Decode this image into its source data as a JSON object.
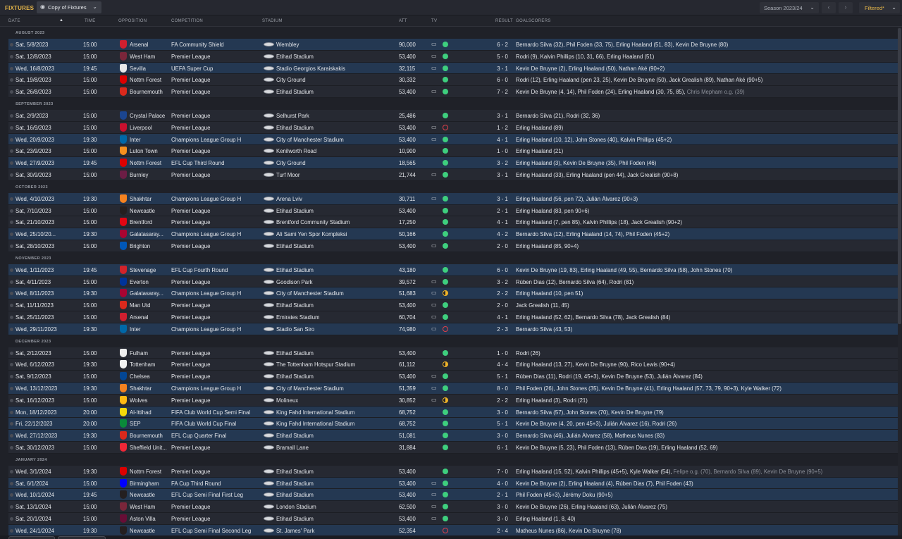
{
  "header": {
    "title": "FIXTURES",
    "view_select": "Copy of Fixtures",
    "season_select": "Season 2023/24",
    "filter_select": "Filtered*"
  },
  "columns": {
    "date": "DATE",
    "time": "TIME",
    "opposition": "OPPOSITION",
    "competition": "COMPETITION",
    "stadium": "STADIUM",
    "att": "ATT",
    "tv": "TV",
    "result": "RESULT",
    "goalscorers": "GOALSCORERS"
  },
  "colors": {
    "win": "#3ecf7e",
    "loss": "#e0404a",
    "draw": "#f0b429",
    "highlight_row": "#243852",
    "accent": "#e8b84a"
  },
  "months": [
    {
      "label": "AUGUST 2023",
      "rows": [
        {
          "date": "Sat, 5/8/2023",
          "time": "15:00",
          "opp": "Arsenal",
          "badge": "#d01f2f",
          "comp": "FA Community Shield",
          "stadium": "Wembley",
          "att": "90,000",
          "tv": true,
          "res": "win",
          "score": "6 - 2",
          "scorers": "Bernardo Silva (32), Phil Foden (33, 75), Erling Haaland (51, 83), Kevin De Bruyne (80)",
          "extra": "",
          "hl": true
        },
        {
          "date": "Sat, 12/8/2023",
          "time": "15:00",
          "opp": "West Ham",
          "badge": "#7a263a",
          "comp": "Premier League",
          "stadium": "Etihad Stadium",
          "att": "53,400",
          "tv": true,
          "res": "win",
          "score": "5 - 0",
          "scorers": "Rodri (9), Kalvin Phillips (10, 31, 66), Erling Haaland (51)",
          "extra": "",
          "hl": false
        },
        {
          "date": "Wed, 16/8/2023",
          "time": "19:45",
          "opp": "Sevilla",
          "badge": "#e8e8e8",
          "comp": "UEFA Super Cup",
          "stadium": "Stadio Georgios Karaiskakis",
          "att": "32,115",
          "tv": true,
          "res": "win",
          "score": "3 - 1",
          "scorers": "Kevin De Bruyne (2), Erling Haaland (50), Nathan Aké (90+2)",
          "extra": "",
          "hl": true
        },
        {
          "date": "Sat, 19/8/2023",
          "time": "15:00",
          "opp": "Nottm Forest",
          "badge": "#dd0000",
          "comp": "Premier League",
          "stadium": "City Ground",
          "att": "30,332",
          "tv": false,
          "res": "win",
          "score": "6 - 0",
          "scorers": "Rodri (12), Erling Haaland (pen 23, 25), Kevin De Bruyne (50), Jack Grealish (89), Nathan Aké (90+5)",
          "extra": "",
          "hl": false
        },
        {
          "date": "Sat, 26/8/2023",
          "time": "15:00",
          "opp": "Bournemouth",
          "badge": "#da291c",
          "comp": "Premier League",
          "stadium": "Etihad Stadium",
          "att": "53,400",
          "tv": true,
          "res": "win",
          "score": "7 - 2",
          "scorers": "Kevin De Bruyne (4, 14), Phil Foden (24), Erling Haaland (30, 75, 85),",
          "extra": "Chris Mepham o.g. (39)",
          "hl": false
        }
      ]
    },
    {
      "label": "SEPTEMBER 2023",
      "rows": [
        {
          "date": "Sat, 2/9/2023",
          "time": "15:00",
          "opp": "Crystal Palace",
          "badge": "#1b458f",
          "comp": "Premier League",
          "stadium": "Selhurst Park",
          "att": "25,486",
          "tv": false,
          "res": "win",
          "score": "3 - 1",
          "scorers": "Bernardo Silva (21), Rodri (32, 36)",
          "extra": "",
          "hl": false
        },
        {
          "date": "Sat, 16/9/2023",
          "time": "15:00",
          "opp": "Liverpool",
          "badge": "#c8102e",
          "comp": "Premier League",
          "stadium": "Etihad Stadium",
          "att": "53,400",
          "tv": true,
          "res": "loss",
          "score": "1 - 2",
          "scorers": "Erling Haaland (89)",
          "extra": "",
          "hl": false
        },
        {
          "date": "Wed, 20/9/2023",
          "time": "19:30",
          "opp": "Inter",
          "badge": "#0068a8",
          "comp": "Champions League Group H",
          "stadium": "City of Manchester Stadium",
          "att": "53,400",
          "tv": true,
          "res": "win",
          "score": "4 - 1",
          "scorers": "Erling Haaland (10, 12), John Stones (40), Kalvin Phillips (45+2)",
          "extra": "",
          "hl": true
        },
        {
          "date": "Sat, 23/9/2023",
          "time": "15:00",
          "opp": "Luton Town",
          "badge": "#f78f1e",
          "comp": "Premier League",
          "stadium": "Kenilworth Road",
          "att": "10,900",
          "tv": false,
          "res": "win",
          "score": "1 - 0",
          "scorers": "Erling Haaland (21)",
          "extra": "",
          "hl": false
        },
        {
          "date": "Wed, 27/9/2023",
          "time": "19:45",
          "opp": "Nottm Forest",
          "badge": "#dd0000",
          "comp": "EFL Cup Third Round",
          "stadium": "City Ground",
          "att": "18,565",
          "tv": false,
          "res": "win",
          "score": "3 - 2",
          "scorers": "Erling Haaland (3), Kevin De Bruyne (35), Phil Foden (46)",
          "extra": "",
          "hl": true
        },
        {
          "date": "Sat, 30/9/2023",
          "time": "15:00",
          "opp": "Burnley",
          "badge": "#6c1d45",
          "comp": "Premier League",
          "stadium": "Turf Moor",
          "att": "21,744",
          "tv": true,
          "res": "win",
          "score": "3 - 1",
          "scorers": "Erling Haaland (33), Erling Haaland (pen 44), Jack Grealish (90+8)",
          "extra": "",
          "hl": false
        }
      ]
    },
    {
      "label": "OCTOBER 2023",
      "rows": [
        {
          "date": "Wed, 4/10/2023",
          "time": "19:30",
          "opp": "Shakhtar",
          "badge": "#f58220",
          "comp": "Champions League Group H",
          "stadium": "Arena Lviv",
          "att": "30,711",
          "tv": true,
          "res": "win",
          "score": "3 - 1",
          "scorers": "Erling Haaland (56, pen 72), Julián Álvarez (90+3)",
          "extra": "",
          "hl": true
        },
        {
          "date": "Sat, 7/10/2023",
          "time": "15:00",
          "opp": "Newcastle",
          "badge": "#241f20",
          "comp": "Premier League",
          "stadium": "Etihad Stadium",
          "att": "53,400",
          "tv": false,
          "res": "win",
          "score": "2 - 1",
          "scorers": "Erling Haaland (83, pen 90+6)",
          "extra": "",
          "hl": false
        },
        {
          "date": "Sat, 21/10/2023",
          "time": "15:00",
          "opp": "Brentford",
          "badge": "#e30613",
          "comp": "Premier League",
          "stadium": "Brentford Community Stadium",
          "att": "17,250",
          "tv": false,
          "res": "win",
          "score": "4 - 1",
          "scorers": "Erling Haaland (7, pen 85), Kalvin Phillips (18), Jack Grealish (90+2)",
          "extra": "",
          "hl": false
        },
        {
          "date": "Wed, 25/10/20...",
          "time": "19:30",
          "opp": "Galatasaray...",
          "badge": "#a90432",
          "comp": "Champions League Group H",
          "stadium": "Ali Sami Yen Spor Kompleksi",
          "att": "50,166",
          "tv": false,
          "res": "win",
          "score": "4 - 2",
          "scorers": "Bernardo Silva (12), Erling Haaland (14, 74), Phil Foden (45+2)",
          "extra": "",
          "hl": true
        },
        {
          "date": "Sat, 28/10/2023",
          "time": "15:00",
          "opp": "Brighton",
          "badge": "#0057b8",
          "comp": "Premier League",
          "stadium": "Etihad Stadium",
          "att": "53,400",
          "tv": true,
          "res": "win",
          "score": "2 - 0",
          "scorers": "Erling Haaland (85, 90+4)",
          "extra": "",
          "hl": false
        }
      ]
    },
    {
      "label": "NOVEMBER 2023",
      "rows": [
        {
          "date": "Wed, 1/11/2023",
          "time": "19:45",
          "opp": "Stevenage",
          "badge": "#d2232a",
          "comp": "EFL Cup Fourth Round",
          "stadium": "Etihad Stadium",
          "att": "43,180",
          "tv": false,
          "res": "win",
          "score": "6 - 0",
          "scorers": "Kevin De Bruyne (19, 83), Erling Haaland (49, 55), Bernardo Silva (58), John Stones (70)",
          "extra": "",
          "hl": true
        },
        {
          "date": "Sat, 4/11/2023",
          "time": "15:00",
          "opp": "Everton",
          "badge": "#003399",
          "comp": "Premier League",
          "stadium": "Goodison Park",
          "att": "39,572",
          "tv": true,
          "res": "win",
          "score": "3 - 2",
          "scorers": "Rúben Dias (12), Bernardo Silva (64), Rodri (81)",
          "extra": "",
          "hl": false
        },
        {
          "date": "Wed, 8/11/2023",
          "time": "19:30",
          "opp": "Galatasaray...",
          "badge": "#a90432",
          "comp": "Champions League Group H",
          "stadium": "City of Manchester Stadium",
          "att": "51,683",
          "tv": true,
          "res": "draw",
          "score": "2 - 2",
          "scorers": "Erling Haaland (10, pen 51)",
          "extra": "",
          "hl": true
        },
        {
          "date": "Sat, 11/11/2023",
          "time": "15:00",
          "opp": "Man Utd",
          "badge": "#da291c",
          "comp": "Premier League",
          "stadium": "Etihad Stadium",
          "att": "53,400",
          "tv": true,
          "res": "win",
          "score": "2 - 0",
          "scorers": "Jack Grealish (11, 45)",
          "extra": "",
          "hl": false
        },
        {
          "date": "Sat, 25/11/2023",
          "time": "15:00",
          "opp": "Arsenal",
          "badge": "#d01f2f",
          "comp": "Premier League",
          "stadium": "Emirates Stadium",
          "att": "60,704",
          "tv": true,
          "res": "win",
          "score": "4 - 1",
          "scorers": "Erling Haaland (52, 62), Bernardo Silva (78), Jack Grealish (84)",
          "extra": "",
          "hl": false
        },
        {
          "date": "Wed, 29/11/2023",
          "time": "19:30",
          "opp": "Inter",
          "badge": "#0068a8",
          "comp": "Champions League Group H",
          "stadium": "Stadio San Siro",
          "att": "74,980",
          "tv": true,
          "res": "loss",
          "score": "2 - 3",
          "scorers": "Bernardo Silva (43, 53)",
          "extra": "",
          "hl": true
        }
      ]
    },
    {
      "label": "DECEMBER 2023",
      "rows": [
        {
          "date": "Sat, 2/12/2023",
          "time": "15:00",
          "opp": "Fulham",
          "badge": "#eeeeee",
          "comp": "Premier League",
          "stadium": "Etihad Stadium",
          "att": "53,400",
          "tv": false,
          "res": "win",
          "score": "1 - 0",
          "scorers": "Rodri (26)",
          "extra": "",
          "hl": false
        },
        {
          "date": "Wed, 6/12/2023",
          "time": "19:30",
          "opp": "Tottenham",
          "badge": "#f2f2f2",
          "comp": "Premier League",
          "stadium": "The Tottenham Hotspur Stadium",
          "att": "61,112",
          "tv": false,
          "res": "draw",
          "score": "4 - 4",
          "scorers": "Erling Haaland (13, 27), Kevin De Bruyne (90), Rico Lewis (90+4)",
          "extra": "",
          "hl": false
        },
        {
          "date": "Sat, 9/12/2023",
          "time": "15:00",
          "opp": "Chelsea",
          "badge": "#034694",
          "comp": "Premier League",
          "stadium": "Etihad Stadium",
          "att": "53,400",
          "tv": true,
          "res": "win",
          "score": "5 - 1",
          "scorers": "Rúben Dias (11), Rodri (19, 45+3), Kevin De Bruyne (53), Julián Álvarez (84)",
          "extra": "",
          "hl": false
        },
        {
          "date": "Wed, 13/12/2023",
          "time": "19:30",
          "opp": "Shakhtar",
          "badge": "#f58220",
          "comp": "Champions League Group H",
          "stadium": "City of Manchester Stadium",
          "att": "51,359",
          "tv": true,
          "res": "win",
          "score": "8 - 0",
          "scorers": "Phil Foden (26), John Stones (35), Kevin De Bruyne (41), Erling Haaland (57, 73, 79, 90+3), Kyle Walker (72)",
          "extra": "",
          "hl": true
        },
        {
          "date": "Sat, 16/12/2023",
          "time": "15:00",
          "opp": "Wolves",
          "badge": "#fdb913",
          "comp": "Premier League",
          "stadium": "Molineux",
          "att": "30,852",
          "tv": true,
          "res": "draw",
          "score": "2 - 2",
          "scorers": "Erling Haaland (3), Rodri (21)",
          "extra": "",
          "hl": false
        },
        {
          "date": "Mon, 18/12/2023",
          "time": "20:00",
          "opp": "Al-Ittihad",
          "badge": "#f5d90a",
          "comp": "FIFA Club World Cup Semi Final",
          "stadium": "King Fahd International Stadium",
          "att": "68,752",
          "tv": false,
          "res": "win",
          "score": "3 - 0",
          "scorers": "Bernardo Silva (57), John Stones (70), Kevin De Bruyne (79)",
          "extra": "",
          "hl": true
        },
        {
          "date": "Fri, 22/12/2023",
          "time": "20:00",
          "opp": "SEP",
          "badge": "#0a8a3a",
          "comp": "FIFA Club World Cup Final",
          "stadium": "King Fahd International Stadium",
          "att": "68,752",
          "tv": false,
          "res": "win",
          "score": "5 - 1",
          "scorers": "Kevin De Bruyne (4, 20, pen 45+3), Julián Álvarez (16), Rodri (26)",
          "extra": "",
          "hl": true
        },
        {
          "date": "Wed, 27/12/2023",
          "time": "19:30",
          "opp": "Bournemouth",
          "badge": "#da291c",
          "comp": "EFL Cup Quarter Final",
          "stadium": "Etihad Stadium",
          "att": "51,081",
          "tv": false,
          "res": "win",
          "score": "3 - 0",
          "scorers": "Bernardo Silva (46), Julián Álvarez (58), Matheus Nunes (83)",
          "extra": "",
          "hl": true
        },
        {
          "date": "Sat, 30/12/2023",
          "time": "15:00",
          "opp": "Sheffield Unit...",
          "badge": "#ee2737",
          "comp": "Premier League",
          "stadium": "Bramall Lane",
          "att": "31,884",
          "tv": false,
          "res": "win",
          "score": "6 - 1",
          "scorers": "Kevin De Bruyne (5, 23), Phil Foden (13), Rúben Dias (19), Erling Haaland (52, 69)",
          "extra": "",
          "hl": false
        }
      ]
    },
    {
      "label": "JANUARY 2024",
      "rows": [
        {
          "date": "Wed, 3/1/2024",
          "time": "19:30",
          "opp": "Nottm Forest",
          "badge": "#dd0000",
          "comp": "Premier League",
          "stadium": "Etihad Stadium",
          "att": "53,400",
          "tv": false,
          "res": "win",
          "score": "7 - 0",
          "scorers": "Erling Haaland (15, 52), Kalvin Phillips (45+5), Kyle Walker (54),",
          "extra": "Felipe o.g. (70), Bernardo Silva (89), Kevin De Bruyne (90+5)",
          "hl": false
        },
        {
          "date": "Sat, 6/1/2024",
          "time": "15:00",
          "opp": "Birmingham",
          "badge": "#0000ff",
          "comp": "FA Cup Third Round",
          "stadium": "Etihad Stadium",
          "att": "53,400",
          "tv": true,
          "res": "win",
          "score": "4 - 0",
          "scorers": "Kevin De Bruyne (2), Erling Haaland (4), Rúben Dias (7), Phil Foden (43)",
          "extra": "",
          "hl": true
        },
        {
          "date": "Wed, 10/1/2024",
          "time": "19:45",
          "opp": "Newcastle",
          "badge": "#241f20",
          "comp": "EFL Cup Semi Final First Leg",
          "stadium": "Etihad Stadium",
          "att": "53,400",
          "tv": true,
          "res": "win",
          "score": "2 - 1",
          "scorers": "Phil Foden (45+3), Jérémy Doku (90+5)",
          "extra": "",
          "hl": true
        },
        {
          "date": "Sat, 13/1/2024",
          "time": "15:00",
          "opp": "West Ham",
          "badge": "#7a263a",
          "comp": "Premier League",
          "stadium": "London Stadium",
          "att": "62,500",
          "tv": true,
          "res": "win",
          "score": "3 - 0",
          "scorers": "Kevin De Bruyne (26), Erling Haaland (63), Julián Álvarez (75)",
          "extra": "",
          "hl": false
        },
        {
          "date": "Sat, 20/1/2024",
          "time": "15:00",
          "opp": "Aston Villa",
          "badge": "#670e36",
          "comp": "Premier League",
          "stadium": "Etihad Stadium",
          "att": "53,400",
          "tv": true,
          "res": "win",
          "score": "3 - 0",
          "scorers": "Erling Haaland (1, 8, 40)",
          "extra": "",
          "hl": false
        },
        {
          "date": "Wed, 24/1/2024",
          "time": "19:30",
          "opp": "Newcastle",
          "badge": "#241f20",
          "comp": "EFL Cup Semi Final Second Leg",
          "stadium": "St. James' Park",
          "att": "52,354",
          "tv": false,
          "res": "loss",
          "score": "2 - 4",
          "scorers": "Matheus Nunes (86), Kevin De Bruyne (78)",
          "extra": "",
          "hl": true
        }
      ]
    }
  ]
}
